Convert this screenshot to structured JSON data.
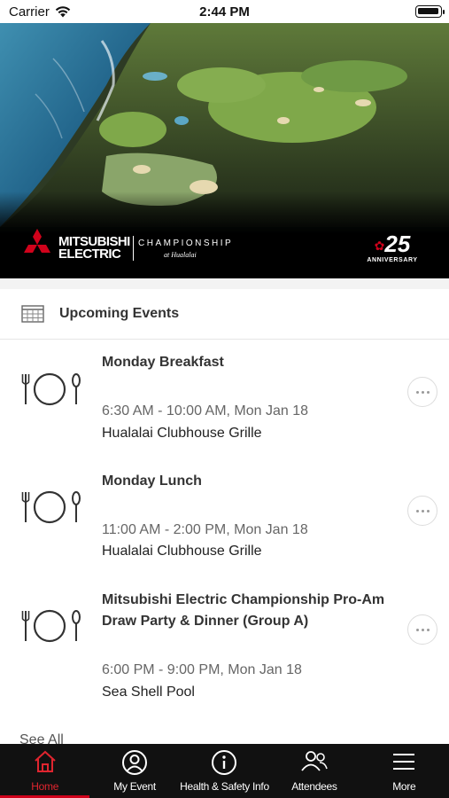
{
  "status_bar": {
    "carrier": "Carrier",
    "time": "2:44 PM"
  },
  "hero": {
    "brand_line1": "MITSUBISHI",
    "brand_line2": "ELECTRIC",
    "championship": "CHAMPIONSHIP",
    "championship_sub": "at Hualalai",
    "anniversary_number": "25",
    "anniversary_label": "ANNIVERSARY"
  },
  "section": {
    "title": "Upcoming Events",
    "icon": "calendar-grid-icon"
  },
  "events": [
    {
      "name": "Monday Breakfast",
      "time": "6:30 AM - 10:00 AM, Mon Jan 18",
      "location": "Hualalai Clubhouse Grille",
      "icon": "dining-icon"
    },
    {
      "name": "Monday Lunch",
      "time": "11:00 AM - 2:00 PM, Mon Jan 18",
      "location": "Hualalai Clubhouse Grille",
      "icon": "dining-icon"
    },
    {
      "name": "Mitsubishi Electric Championship Pro-Am Draw Party & Dinner (Group A)",
      "time": "6:00 PM - 9:00 PM, Mon Jan 18",
      "location": "Sea Shell Pool",
      "icon": "dining-icon"
    }
  ],
  "see_all": "See All",
  "tabs": [
    {
      "label": "Home",
      "icon": "home-icon",
      "active": true
    },
    {
      "label": "My Event",
      "icon": "user-circle-icon",
      "active": false
    },
    {
      "label": "Health & Safety Info",
      "icon": "info-icon",
      "active": false
    },
    {
      "label": "Attendees",
      "icon": "people-icon",
      "active": false
    },
    {
      "label": "More",
      "icon": "menu-icon",
      "active": false
    }
  ],
  "colors": {
    "accent": "#d0021b",
    "tab_bar": "#111111"
  }
}
